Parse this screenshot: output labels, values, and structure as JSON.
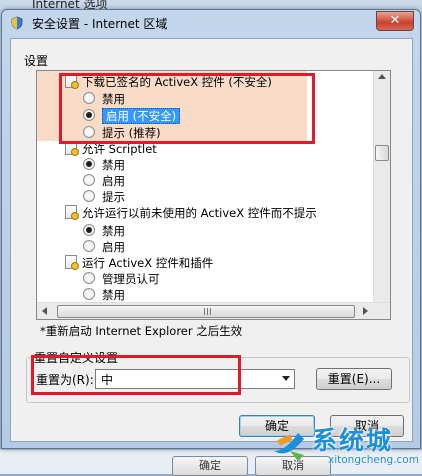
{
  "background_window": {
    "title": "Internet 选项",
    "ok_label": "确定",
    "cancel_label": "取消"
  },
  "dialog": {
    "title": "安全设置 - Internet 区域",
    "close_symbol": "✕",
    "settings_label": "设置",
    "items": [
      {
        "kind": "group",
        "label": "下载已签名的 ActiveX 控件 (不安全)"
      },
      {
        "kind": "option",
        "label": "禁用",
        "checked": false,
        "selected": false
      },
      {
        "kind": "option",
        "label": "启用 (不安全)",
        "checked": true,
        "selected": true
      },
      {
        "kind": "option",
        "label": "提示 (推荐)",
        "checked": false,
        "selected": false
      },
      {
        "kind": "group",
        "label": "允许 Scriptlet"
      },
      {
        "kind": "option",
        "label": "禁用",
        "checked": true,
        "selected": false
      },
      {
        "kind": "option",
        "label": "启用",
        "checked": false,
        "selected": false
      },
      {
        "kind": "option",
        "label": "提示",
        "checked": false,
        "selected": false
      },
      {
        "kind": "group",
        "label": "允许运行以前未使用的 ActiveX 控件而不提示"
      },
      {
        "kind": "option",
        "label": "禁用",
        "checked": true,
        "selected": false
      },
      {
        "kind": "option",
        "label": "启用",
        "checked": false,
        "selected": false
      },
      {
        "kind": "group",
        "label": "运行 ActiveX 控件和插件"
      },
      {
        "kind": "option",
        "label": "管理员认可",
        "checked": false,
        "selected": false
      },
      {
        "kind": "option",
        "label": "禁用",
        "checked": false,
        "selected": false
      }
    ],
    "restart_note": "*重新启动 Internet Explorer 之后生效",
    "reset_group_title": "重置自定义设置",
    "reset_to_label": "重置为(R):",
    "reset_value": "中",
    "reset_button": "重置(E)...",
    "ok_button": "确定",
    "cancel_button": "取消"
  },
  "watermark": {
    "brand": "系统城",
    "url": "xitongcheng.com"
  },
  "colors": {
    "highlight_box": "#e01a2a",
    "selection": "#3399ff",
    "row_highlight": "#f9dcc8"
  }
}
